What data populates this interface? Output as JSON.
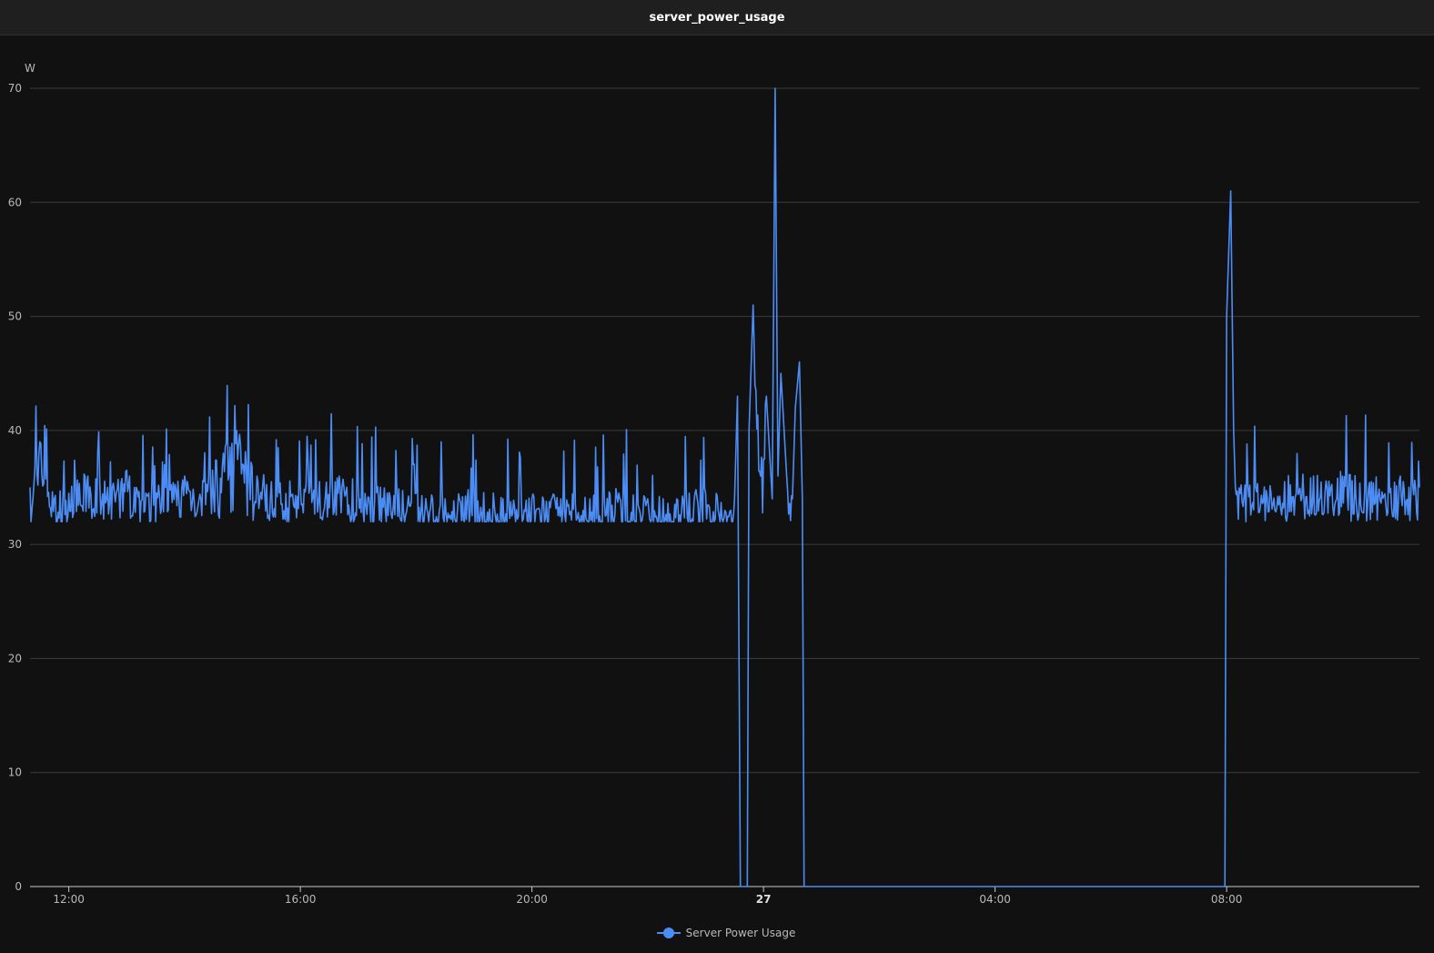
{
  "header": {
    "title": "server_power_usage"
  },
  "colors": {
    "series": "#4c8df5",
    "background": "#111112"
  },
  "chart_data": {
    "type": "line",
    "title": "server_power_usage",
    "ylabel": "W",
    "xlabel": "",
    "ylim": [
      0,
      70
    ],
    "yticks": [
      0,
      10,
      20,
      30,
      40,
      50,
      60,
      70
    ],
    "xlim_hours": [
      11.33,
      35.33
    ],
    "xticks": [
      {
        "label": "12:00",
        "hour": 12
      },
      {
        "label": "16:00",
        "hour": 16
      },
      {
        "label": "20:00",
        "hour": 20
      },
      {
        "label": "27",
        "hour": 24,
        "bold": true
      },
      {
        "label": "04:00",
        "hour": 28
      },
      {
        "label": "08:00",
        "hour": 32
      }
    ],
    "grid": true,
    "legend_position": "bottom-center",
    "series": [
      {
        "name": "Server Power Usage",
        "points": [
          [
            11.33,
            35.0
          ],
          [
            11.5,
            39.0
          ],
          [
            11.75,
            34.0
          ],
          [
            12.0,
            34.5
          ],
          [
            12.33,
            36.0
          ],
          [
            12.67,
            35.0
          ],
          [
            13.0,
            36.5
          ],
          [
            13.33,
            34.5
          ],
          [
            13.67,
            35.0
          ],
          [
            14.0,
            36.0
          ],
          [
            14.33,
            35.5
          ],
          [
            14.67,
            38.0
          ],
          [
            14.9,
            40.0
          ],
          [
            15.25,
            36.0
          ],
          [
            15.5,
            35.5
          ],
          [
            16.0,
            35.0
          ],
          [
            16.33,
            35.5
          ],
          [
            16.67,
            36.0
          ],
          [
            17.0,
            35.0
          ],
          [
            17.5,
            34.5
          ],
          [
            18.0,
            34.5
          ],
          [
            18.5,
            34.0
          ],
          [
            19.0,
            34.5
          ],
          [
            19.5,
            34.0
          ],
          [
            20.0,
            34.0
          ],
          [
            20.5,
            34.0
          ],
          [
            21.0,
            34.0
          ],
          [
            21.5,
            34.5
          ],
          [
            22.0,
            34.0
          ],
          [
            22.5,
            34.0
          ],
          [
            23.0,
            34.5
          ],
          [
            23.5,
            34.0
          ],
          [
            23.55,
            43.0
          ],
          [
            23.6,
            0.0
          ],
          [
            23.72,
            0.0
          ],
          [
            23.75,
            40.0
          ],
          [
            23.82,
            51.0
          ],
          [
            23.95,
            36.0
          ],
          [
            24.05,
            43.0
          ],
          [
            24.15,
            34.0
          ],
          [
            24.2,
            70.0
          ],
          [
            24.25,
            36.0
          ],
          [
            24.3,
            45.0
          ],
          [
            24.4,
            36.0
          ],
          [
            24.5,
            34.0
          ],
          [
            24.55,
            42.0
          ],
          [
            24.62,
            46.0
          ],
          [
            24.67,
            34.0
          ],
          [
            24.7,
            0.0
          ],
          [
            28.0,
            0.0
          ],
          [
            31.97,
            0.0
          ],
          [
            32.0,
            50.0
          ],
          [
            32.07,
            61.0
          ],
          [
            32.12,
            40.0
          ],
          [
            32.15,
            35.0
          ],
          [
            32.5,
            35.0
          ],
          [
            33.0,
            35.5
          ],
          [
            33.5,
            36.0
          ],
          [
            34.0,
            36.0
          ],
          [
            34.5,
            35.5
          ],
          [
            35.0,
            36.0
          ],
          [
            35.33,
            35.0
          ]
        ]
      }
    ]
  }
}
